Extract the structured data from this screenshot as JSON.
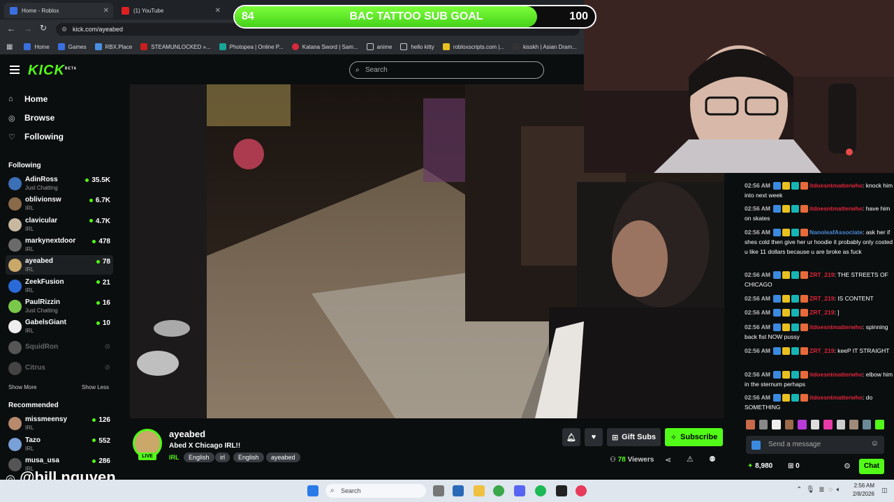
{
  "browser": {
    "tabs": [
      {
        "label": "Home - Roblox"
      },
      {
        "label": "(1) YouTube"
      }
    ],
    "url": "kick.com/ayeabed",
    "bookmarks": [
      "Home",
      "Games",
      "RBX.Place",
      "STEAMUNLOCKED »...",
      "Photopea | Online P...",
      "Katana Sword | Sam...",
      "anime",
      "hello kitty",
      "robloxscripts.com |...",
      "kisskh | Asian Dram..."
    ]
  },
  "overlay": {
    "goal_current": "84",
    "goal_label": "BAC TATTOO SUB GOAL",
    "goal_target": "100",
    "goal_progress": 0.84,
    "watermark": "@bill.nguyen"
  },
  "header": {
    "logo": "KICK",
    "logo_beta": "BETA",
    "search_placeholder": "Search"
  },
  "sidebar": {
    "nav": [
      {
        "label": "Home",
        "icon": "home-icon"
      },
      {
        "label": "Browse",
        "icon": "compass-icon"
      },
      {
        "label": "Following",
        "icon": "heart-icon"
      }
    ],
    "following_title": "Following",
    "following": [
      {
        "name": "AdinRoss",
        "category": "Just Chatting",
        "viewers": "35.5K",
        "color": "#3b6fb6"
      },
      {
        "name": "oblivionsw",
        "category": "IRL",
        "viewers": "6.7K",
        "color": "#8a6a4a"
      },
      {
        "name": "clavicular",
        "category": "IRL",
        "viewers": "4.7K",
        "color": "#c8b8a0"
      },
      {
        "name": "markynextdoor",
        "category": "IRL",
        "viewers": "478",
        "color": "#6a6a6a"
      },
      {
        "name": "ayeabed",
        "category": "IRL",
        "viewers": "78",
        "color": "#c9a86a"
      },
      {
        "name": "ZeekFusion",
        "category": "IRL",
        "viewers": "21",
        "color": "#2a6ad8"
      },
      {
        "name": "PaulRizzin",
        "category": "Just Chatting",
        "viewers": "16",
        "color": "#7ac84a"
      },
      {
        "name": "GabelsGiant",
        "category": "IRL",
        "viewers": "10",
        "color": "#eeeeee"
      }
    ],
    "offline": [
      {
        "name": "SquidRon",
        "color": "#555"
      },
      {
        "name": "Citrus",
        "color": "#444"
      }
    ],
    "show_more": "Show More",
    "show_less": "Show Less",
    "recommended_title": "Recommended",
    "recommended": [
      {
        "name": "missmeensy",
        "category": "IRL",
        "viewers": "126",
        "color": "#b68a6a"
      },
      {
        "name": "Tazo",
        "category": "IRL",
        "viewers": "552",
        "color": "#7aa0d8"
      },
      {
        "name": "musa_usa",
        "category": "IRL",
        "viewers": "286",
        "color": "#555"
      }
    ]
  },
  "stream": {
    "channel": "ayeabed",
    "title": "Abed X Chicago IRL!!",
    "live": "LIVE",
    "category": "IRL",
    "tags": [
      "English",
      "irl",
      "English",
      "ayeabed"
    ],
    "viewers": "78",
    "viewers_label": "Viewers",
    "gift_subs": "Gift Subs",
    "subscribe": "Subscribe"
  },
  "chat": {
    "messages": [
      {
        "time": "02:56 AM",
        "user": "itdoesntmatterwho",
        "color": "#e0243a",
        "text": "knock him into next week"
      },
      {
        "time": "02:56 AM",
        "user": "itdoesntmatterwho",
        "color": "#e0243a",
        "text": "have him on skates"
      },
      {
        "time": "02:56 AM",
        "user": "NanoleafAssociate",
        "color": "#4a8ad8",
        "text": "ask her if shes cold then give her ur hoodie it probably only costed u like 11 dollars because u are broke as fuck"
      },
      {
        "time": "02:56 AM",
        "user": "ZRT_219",
        "color": "#e0243a",
        "text": "THE STREETS OF CHICAGO"
      },
      {
        "time": "02:56 AM",
        "user": "ZRT_219",
        "color": "#e0243a",
        "text": "IS CONTENT"
      },
      {
        "time": "02:56 AM",
        "user": "ZRT_219",
        "color": "#e0243a",
        "text": "]"
      },
      {
        "time": "02:56 AM",
        "user": "itdoesntmatterwho",
        "color": "#e0243a",
        "text": "spinning back fist NOW pussy"
      },
      {
        "time": "02:56 AM",
        "user": "ZRT_219",
        "color": "#e0243a",
        "text": "keeP IT STRAIGHT"
      },
      {
        "time": "02:56 AM",
        "user": "itdoesntmatterwho",
        "color": "#e0243a",
        "text": "elbow him in the sternum perhaps"
      },
      {
        "time": "02:56 AM",
        "user": "itdoesntmatterwho",
        "color": "#e0243a",
        "text": "do SOMETHING"
      }
    ],
    "input_placeholder": "Send a message",
    "points": "8,980",
    "gifts": "0",
    "chat_button": "Chat"
  },
  "taskbar": {
    "search_placeholder": "Search",
    "time": "2:56 AM",
    "date": "2/8/2026"
  }
}
